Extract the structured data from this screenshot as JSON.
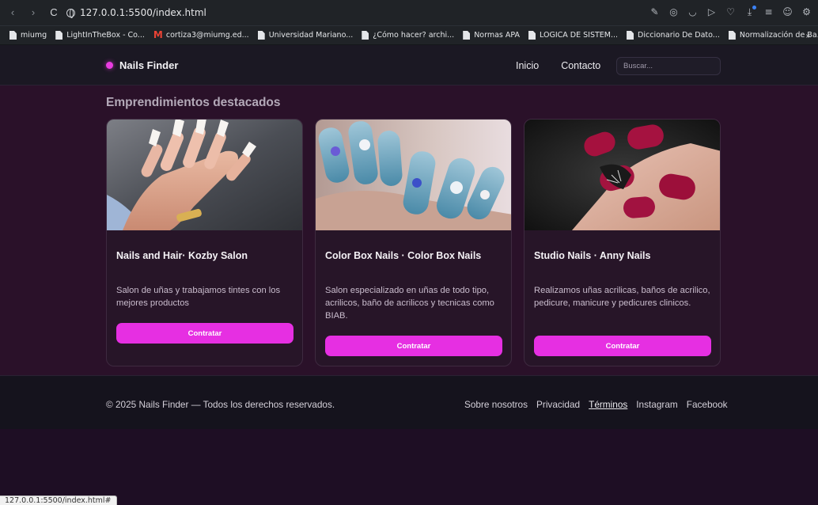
{
  "browser": {
    "url": "127.0.0.1:5500/index.html",
    "bookmarks": [
      {
        "label": "miumg",
        "icon": "document-icon"
      },
      {
        "label": "LightInTheBox - Co...",
        "icon": "document-icon"
      },
      {
        "label": "cortiza3@miumg.ed...",
        "icon": "gmail-icon"
      },
      {
        "label": "Universidad Mariano...",
        "icon": "document-icon"
      },
      {
        "label": "¿Cómo hacer? archi...",
        "icon": "document-icon"
      },
      {
        "label": "Normas APA",
        "icon": "document-icon"
      },
      {
        "label": "LOGICA DE SISTEM...",
        "icon": "document-icon"
      },
      {
        "label": "Diccionario De Dato...",
        "icon": "document-icon"
      },
      {
        "label": "Normalización de Ba...",
        "icon": "document-icon"
      }
    ],
    "more_label": "»",
    "status_url": "127.0.0.1:5500/index.html#"
  },
  "header": {
    "brand": "Nails Finder",
    "brand_color": "#e93ce0",
    "nav": [
      "Inicio",
      "Contacto"
    ],
    "search_placeholder": "Buscar..."
  },
  "main": {
    "section_title": "Emprendimientos destacados",
    "cards": [
      {
        "title": "Nails and Hair· Kozby Salon",
        "description": "Salon de uñas y trabajamos tintes con los mejores productos",
        "button": "Contratar"
      },
      {
        "title": "Color Box Nails · Color Box Nails",
        "description": "Salon especializado en uñas de todo tipo, acrilicos, baño de acrilicos y tecnicas como BIAB.",
        "button": "Contratar"
      },
      {
        "title": "Studio Nails · Anny Nails",
        "description": "Realizamos uñas acrilicas, baños de acrilico, pedicure, manicure y pedicures clinicos.",
        "button": "Contratar"
      }
    ],
    "accent_color": "#e62fe2"
  },
  "footer": {
    "copyright": "© 2025 Nails Finder — Todos los derechos reservados.",
    "links": [
      "Sobre nosotros",
      "Privacidad",
      "Términos",
      "Instagram",
      "Facebook"
    ]
  }
}
